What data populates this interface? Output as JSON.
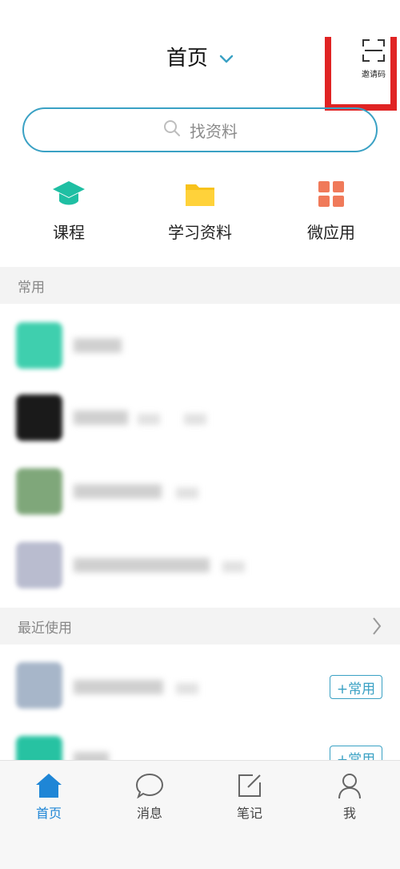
{
  "header": {
    "title": "首页",
    "invite_label": "邀请码"
  },
  "search": {
    "placeholder": "找资料"
  },
  "quick_entries": [
    {
      "label": "课程",
      "icon": "graduation-cap-icon"
    },
    {
      "label": "学习资料",
      "icon": "folder-icon"
    },
    {
      "label": "微应用",
      "icon": "apps-grid-icon"
    }
  ],
  "sections": {
    "frequent": {
      "title": "常用"
    },
    "recent": {
      "title": "最近使用"
    }
  },
  "recent_items": [
    {
      "add_label": "+常用"
    },
    {
      "add_label": "+常用"
    }
  ],
  "tabbar": {
    "items": [
      {
        "label": "首页",
        "icon": "home-icon",
        "active": true
      },
      {
        "label": "消息",
        "icon": "chat-bubble-icon",
        "active": false
      },
      {
        "label": "笔记",
        "icon": "note-edit-icon",
        "active": false
      },
      {
        "label": "我",
        "icon": "person-icon",
        "active": false
      }
    ]
  },
  "colors": {
    "accent": "#3aa1c4",
    "highlight": "#e02424",
    "tab_active": "#1f86d6"
  }
}
